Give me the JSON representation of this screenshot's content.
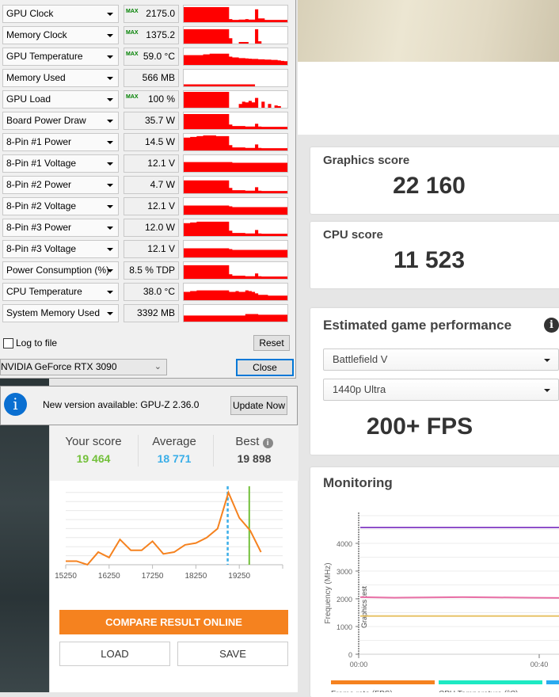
{
  "gpuz": {
    "sensors": [
      {
        "name": "GPU Clock",
        "value": "2175.0 MHz",
        "max": true,
        "history": [
          0.95,
          0.95,
          0.95,
          0.95,
          0.95,
          0.95,
          0.95,
          0.95,
          0.95,
          0.95,
          0.95,
          0.95,
          0.95,
          0.95,
          0.15,
          0.1,
          0.1,
          0.12,
          0.12,
          0.15,
          0.12,
          0.12,
          0.8,
          0.2,
          0.2,
          0.1,
          0.1,
          0.1,
          0.1,
          0.1,
          0.1,
          0.1
        ]
      },
      {
        "name": "Memory Clock",
        "value": "1375.2 MHz",
        "max": true,
        "history": [
          0.9,
          0.9,
          0.9,
          0.9,
          0.9,
          0.9,
          0.9,
          0.9,
          0.9,
          0.9,
          0.9,
          0.9,
          0.9,
          0.9,
          0.3,
          0,
          0,
          0.05,
          0.05,
          0.05,
          0,
          0,
          0.9,
          0.1,
          0,
          0,
          0,
          0,
          0,
          0,
          0,
          0
        ]
      },
      {
        "name": "GPU Temperature",
        "value": "59.0 °C",
        "max": true,
        "history": [
          0.6,
          0.6,
          0.6,
          0.6,
          0.6,
          0.6,
          0.65,
          0.65,
          0.7,
          0.7,
          0.7,
          0.7,
          0.7,
          0.7,
          0.5,
          0.45,
          0.45,
          0.4,
          0.4,
          0.38,
          0.36,
          0.35,
          0.35,
          0.32,
          0.32,
          0.3,
          0.3,
          0.28,
          0.28,
          0.25,
          0.22,
          0.2
        ]
      },
      {
        "name": "Memory Used",
        "value": "566 MB",
        "max": false,
        "history": [
          0.08,
          0.08,
          0.08,
          0.08,
          0.08,
          0.08,
          0.08,
          0.08,
          0.08,
          0.08,
          0.08,
          0.08,
          0.08,
          0.08,
          0.08,
          0.08,
          0.08,
          0.08,
          0.08,
          0.08,
          0.08,
          0.08,
          0,
          0,
          0,
          0,
          0,
          0,
          0,
          0,
          0,
          0
        ]
      },
      {
        "name": "GPU Load",
        "value": "100 %",
        "max": true,
        "history": [
          1,
          1,
          1,
          1,
          1,
          1,
          1,
          1,
          1,
          1,
          1,
          1,
          1,
          1,
          0,
          0,
          0,
          0.2,
          0.35,
          0.3,
          0.4,
          0.3,
          0.6,
          0,
          0.35,
          0,
          0.2,
          0,
          0.1,
          0.05,
          0,
          0
        ]
      },
      {
        "name": "Board Power Draw",
        "value": "35.7 W",
        "max": false,
        "history": [
          0.95,
          0.95,
          0.95,
          0.95,
          0.95,
          0.95,
          0.95,
          0.95,
          0.95,
          0.95,
          0.95,
          0.95,
          0.95,
          0.95,
          0.25,
          0.15,
          0.15,
          0.15,
          0.15,
          0.12,
          0.12,
          0.12,
          0.3,
          0.12,
          0.1,
          0.1,
          0.1,
          0.1,
          0.1,
          0.1,
          0.1,
          0.1
        ]
      },
      {
        "name": "8-Pin #1 Power",
        "value": "14.5 W",
        "max": false,
        "history": [
          0.8,
          0.8,
          0.85,
          0.85,
          0.9,
          0.9,
          0.95,
          0.95,
          0.95,
          0.95,
          0.9,
          0.9,
          0.9,
          0.9,
          0.3,
          0.15,
          0.15,
          0.15,
          0.15,
          0.12,
          0.12,
          0.12,
          0.35,
          0.12,
          0.1,
          0.1,
          0.1,
          0.1,
          0.1,
          0.1,
          0.1,
          0.1
        ]
      },
      {
        "name": "8-Pin #1 Voltage",
        "value": "12.1 V",
        "max": false,
        "history": [
          0.6,
          0.6,
          0.6,
          0.6,
          0.6,
          0.6,
          0.6,
          0.6,
          0.6,
          0.6,
          0.6,
          0.6,
          0.6,
          0.6,
          0.6,
          0.55,
          0.55,
          0.55,
          0.55,
          0.55,
          0.55,
          0.55,
          0.55,
          0.55,
          0.55,
          0.55,
          0.55,
          0.55,
          0.55,
          0.55,
          0.55,
          0.55
        ]
      },
      {
        "name": "8-Pin #2 Power",
        "value": "4.7 W",
        "max": false,
        "history": [
          0.8,
          0.8,
          0.8,
          0.8,
          0.8,
          0.8,
          0.8,
          0.8,
          0.8,
          0.8,
          0.8,
          0.8,
          0.8,
          0.8,
          0.3,
          0.15,
          0.15,
          0.15,
          0.15,
          0.12,
          0.12,
          0.12,
          0.35,
          0.12,
          0.1,
          0.1,
          0.1,
          0.1,
          0.1,
          0.1,
          0.1,
          0.1
        ]
      },
      {
        "name": "8-Pin #2 Voltage",
        "value": "12.1 V",
        "max": false,
        "history": [
          0.55,
          0.55,
          0.55,
          0.55,
          0.55,
          0.55,
          0.55,
          0.55,
          0.55,
          0.55,
          0.55,
          0.55,
          0.55,
          0.55,
          0.5,
          0.45,
          0.45,
          0.45,
          0.45,
          0.45,
          0.45,
          0.45,
          0.45,
          0.45,
          0.45,
          0.45,
          0.45,
          0.45,
          0.45,
          0.45,
          0.45,
          0.45
        ]
      },
      {
        "name": "8-Pin #3 Power",
        "value": "12.0 W",
        "max": false,
        "history": [
          0.8,
          0.8,
          0.85,
          0.85,
          0.9,
          0.9,
          0.9,
          0.9,
          0.9,
          0.9,
          0.9,
          0.9,
          0.9,
          0.9,
          0.3,
          0.15,
          0.15,
          0.15,
          0.15,
          0.12,
          0.12,
          0.12,
          0.35,
          0.12,
          0.1,
          0.1,
          0.1,
          0.1,
          0.1,
          0.1,
          0.1,
          0.1
        ]
      },
      {
        "name": "8-Pin #3 Voltage",
        "value": "12.1 V",
        "max": false,
        "history": [
          0.55,
          0.55,
          0.55,
          0.55,
          0.55,
          0.55,
          0.55,
          0.55,
          0.55,
          0.55,
          0.55,
          0.55,
          0.55,
          0.55,
          0.5,
          0.45,
          0.45,
          0.45,
          0.45,
          0.45,
          0.45,
          0.45,
          0.45,
          0.45,
          0.45,
          0.45,
          0.45,
          0.45,
          0.45,
          0.45,
          0.45,
          0.45
        ]
      },
      {
        "name": "Power Consumption (%)",
        "value": "8.5 % TDP",
        "max": false,
        "history": [
          0.85,
          0.85,
          0.85,
          0.85,
          0.85,
          0.85,
          0.85,
          0.85,
          0.85,
          0.85,
          0.85,
          0.85,
          0.85,
          0.85,
          0.25,
          0.15,
          0.15,
          0.15,
          0.15,
          0.12,
          0.12,
          0.12,
          0.3,
          0.12,
          0.1,
          0.1,
          0.1,
          0.1,
          0.1,
          0.1,
          0.1,
          0.1
        ]
      },
      {
        "name": "CPU Temperature",
        "value": "38.0 °C",
        "max": false,
        "history": [
          0.5,
          0.5,
          0.55,
          0.55,
          0.6,
          0.6,
          0.6,
          0.6,
          0.6,
          0.6,
          0.6,
          0.6,
          0.6,
          0.6,
          0.5,
          0.5,
          0.55,
          0.5,
          0.5,
          0.6,
          0.55,
          0.5,
          0.4,
          0.3,
          0.3,
          0.3,
          0.25,
          0.25,
          0.25,
          0.25,
          0.25,
          0.25
        ]
      },
      {
        "name": "System Memory Used",
        "value": "3392 MB",
        "max": false,
        "history": [
          0.35,
          0.35,
          0.35,
          0.35,
          0.35,
          0.35,
          0.35,
          0.35,
          0.35,
          0.35,
          0.35,
          0.35,
          0.35,
          0.35,
          0.35,
          0.35,
          0.35,
          0.35,
          0.35,
          0.45,
          0.45,
          0.45,
          0.45,
          0.4,
          0.4,
          0.4,
          0.4,
          0.4,
          0.4,
          0.4,
          0.4,
          0.4
        ]
      }
    ],
    "max_label": "MAX",
    "log_to_file": "Log to file",
    "reset": "Reset",
    "gpu_select": "NVIDIA GeForce RTX 3090",
    "close": "Close",
    "graph_color": "#ff0000"
  },
  "notification": {
    "text": "New version available: GPU-Z 2.36.0",
    "button": "Update Now"
  },
  "result": {
    "your_score_label": "Your score",
    "your_score": "19 464",
    "average_label": "Average",
    "average": "18 771",
    "best_label": "Best",
    "best": "19 898",
    "compare": "COMPARE RESULT ONLINE",
    "load": "LOAD",
    "save": "SAVE"
  },
  "chart_data": [
    {
      "type": "line",
      "x": [
        15250,
        15500,
        15750,
        16000,
        16250,
        16500,
        16750,
        17000,
        17250,
        17500,
        17750,
        18000,
        18250,
        18500,
        18750,
        19000,
        19250,
        19500,
        19750
      ],
      "values": [
        0.4,
        0.4,
        0,
        1.4,
        0.8,
        2.8,
        1.6,
        1.6,
        2.6,
        1.2,
        1.4,
        2.2,
        2.4,
        3.0,
        4.0,
        8.0,
        5.2,
        3.8,
        1.4
      ],
      "tick_labels": [
        "15250",
        "16250",
        "17250",
        "18250",
        "19250"
      ],
      "xlim": [
        15250,
        20250
      ],
      "ylim": [
        0,
        8
      ],
      "grid": true,
      "markers": {
        "average": 18771,
        "your_score": 19464
      },
      "colors": {
        "line": "#f5821f",
        "average": "#3aaee8",
        "your_score": "#73c03a"
      }
    },
    {
      "type": "line",
      "ylabel": "Frequency (MHz)",
      "yticks": [
        "0",
        "1000",
        "2000",
        "3000",
        "4000"
      ],
      "xticks": [
        "00:00",
        "00:40"
      ],
      "ylim": [
        0,
        5000
      ],
      "grid": true,
      "annotation": "Graphics test",
      "series": [
        {
          "values": [
            4570,
            4570,
            4570,
            4570,
            4570,
            4570,
            4570
          ],
          "color": "#8e4fc9"
        },
        {
          "values": [
            2060,
            2040,
            2050,
            2060,
            2050,
            2040,
            2030
          ],
          "color": "#e86fa5"
        },
        {
          "values": [
            1380,
            1380,
            1380,
            1380,
            1380,
            1380,
            1380
          ],
          "color": "#e8c46a"
        }
      ],
      "legend": [
        {
          "label": "Frame rate (FPS)",
          "color": "#f5821f"
        },
        {
          "label": "CPU Temperature (°C)",
          "color": "#1de9c3"
        },
        {
          "label": "",
          "color": "#2aaaf0"
        }
      ]
    }
  ],
  "scores": {
    "graphics_label": "Graphics score",
    "graphics": "22 160",
    "cpu_label": "CPU score",
    "cpu": "11 523"
  },
  "estimate": {
    "title": "Estimated game performance",
    "game": "Battlefield V",
    "preset": "1440p Ultra",
    "fps": "200+ FPS"
  },
  "monitoring": {
    "title": "Monitoring"
  }
}
